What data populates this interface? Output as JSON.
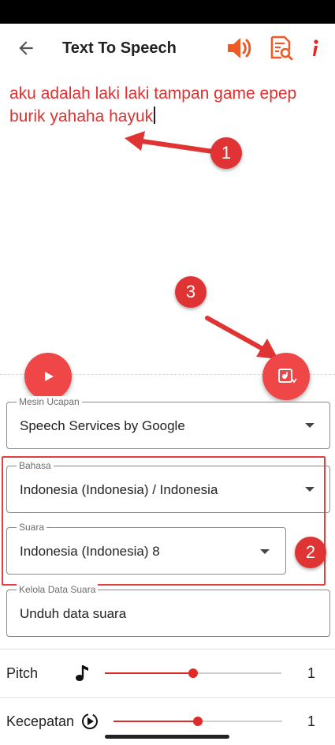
{
  "topbar": {
    "title": "Text To Speech",
    "icons": [
      "back-arrow-icon",
      "speaker-icon",
      "document-search-icon",
      "info-icon"
    ],
    "accent_color": "#ef5a24"
  },
  "editor": {
    "text": "aku adalah laki laki tampan game epep burik yahaha hayuk",
    "text_color": "#e03030"
  },
  "annotations": {
    "marker_1": "1",
    "marker_2": "2",
    "marker_3": "3",
    "color": "#e03434"
  },
  "fabs": {
    "play": "play-icon",
    "save": "save-audio-icon",
    "color": "#ef4747"
  },
  "engine": {
    "label": "Mesin Ucapan",
    "value": "Speech Services by Google"
  },
  "language": {
    "label": "Bahasa",
    "value": "Indonesia (Indonesia) / Indonesia"
  },
  "voice": {
    "label": "Suara",
    "value": "Indonesia (Indonesia) 8"
  },
  "voice_data": {
    "label": "Kelola Data Suara",
    "value": "Unduh data suara"
  },
  "pitch": {
    "label": "Pitch",
    "icon": "music-note-icon",
    "value": "1",
    "level": 0.5
  },
  "speed": {
    "label": "Kecepatan",
    "icon": "speed-play-icon",
    "value": "1",
    "level": 0.5
  }
}
